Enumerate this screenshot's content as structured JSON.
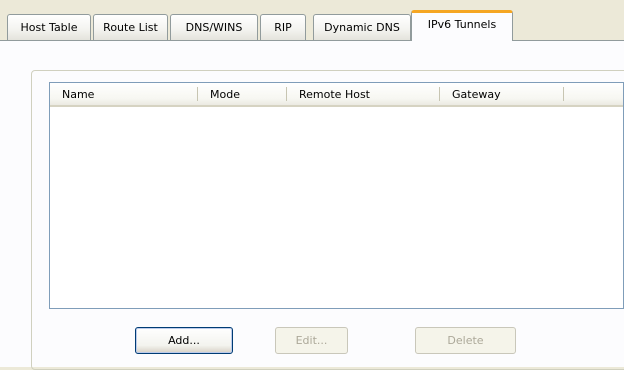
{
  "tabs": [
    {
      "label": "Host Table",
      "selected": false
    },
    {
      "label": "Route List",
      "selected": false
    },
    {
      "label": "DNS/WINS",
      "selected": false
    },
    {
      "label": "RIP",
      "selected": false
    },
    {
      "label": "Dynamic DNS",
      "selected": false
    },
    {
      "label": "IPv6 Tunnels",
      "selected": true
    }
  ],
  "table": {
    "columns": [
      "Name",
      "Mode",
      "Remote Host",
      "Gateway"
    ],
    "rows": []
  },
  "buttons": {
    "add": {
      "label": "Add...",
      "enabled": true
    },
    "edit": {
      "label": "Edit...",
      "enabled": false
    },
    "delete": {
      "label": "Delete",
      "enabled": false
    }
  },
  "colors": {
    "dialog_background": "#ece9d8",
    "selected_tab_accent": "#f5a623",
    "list_border": "#7f9db9"
  }
}
